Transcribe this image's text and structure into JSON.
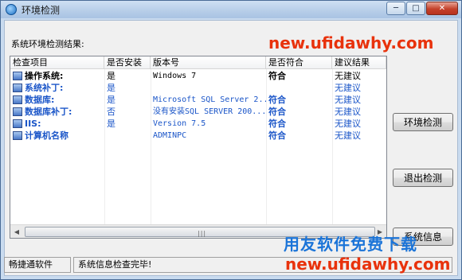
{
  "window": {
    "title": "环境检测",
    "min_glyph": "─",
    "max_glyph": "□",
    "close_glyph": "✕"
  },
  "result_label": "系统环境检测结果:",
  "list": {
    "columns": [
      "检查项目",
      "是否安装",
      "版本号",
      "是否符合",
      "建议结果"
    ],
    "rows": [
      {
        "name": "操作系统:",
        "installed": "是",
        "version": "Windows 7",
        "match": "符合",
        "advice": "无建议",
        "color": "#000000"
      },
      {
        "name": "系统补丁:",
        "installed": "是",
        "version": "",
        "match": "",
        "advice": "无建议",
        "color": "#1a55c8"
      },
      {
        "name": "数据库:",
        "installed": "是",
        "version": "Microsoft SQL Server 2...",
        "match": "符合",
        "advice": "无建议",
        "color": "#1a55c8"
      },
      {
        "name": "数据库补丁:",
        "installed": "否",
        "version": "没有安装SQL SERVER 200...",
        "match": "符合",
        "advice": "无建议",
        "color": "#1a55c8"
      },
      {
        "name": "IIS:",
        "installed": "是",
        "version": "Version 7.5",
        "match": "符合",
        "advice": "无建议",
        "color": "#1a55c8"
      },
      {
        "name": "计算机名称",
        "installed": "",
        "version": "ADMINPC",
        "match": "符合",
        "advice": "无建议",
        "color": "#1a55c8"
      }
    ]
  },
  "buttons": {
    "check": "环境检测",
    "exit": "退出检测",
    "third": "系统信息"
  },
  "status": {
    "left": "畅捷通软件",
    "right": "系统信息检查完毕!"
  },
  "watermarks": {
    "url_top": "new.ufidawhy.com",
    "title": "用友软件免费下载",
    "url_bottom": "new.ufidawhy.com"
  }
}
